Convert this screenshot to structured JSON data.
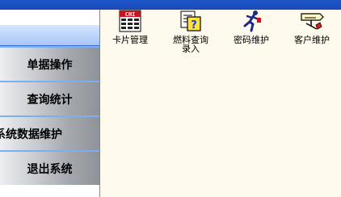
{
  "sidebar": {
    "items": [
      {
        "label": "单据操作"
      },
      {
        "label": "查询统计"
      },
      {
        "label": "系统数据维护"
      },
      {
        "label": "退出系统"
      }
    ]
  },
  "toolbar": {
    "items": [
      {
        "label": "卡片管理",
        "icon": "table-card-icon"
      },
      {
        "label": "燃料查询录入",
        "icon": "document-question-icon"
      },
      {
        "label": "密码维护",
        "icon": "running-figure-icon"
      },
      {
        "label": "客户维护",
        "icon": "signpost-icon"
      }
    ],
    "card_icon_text": "CHI"
  },
  "colors": {
    "title_bar": "#1b4fc1",
    "workspace_bg": "#fdf9ec",
    "nav_border": "#7caef0"
  }
}
